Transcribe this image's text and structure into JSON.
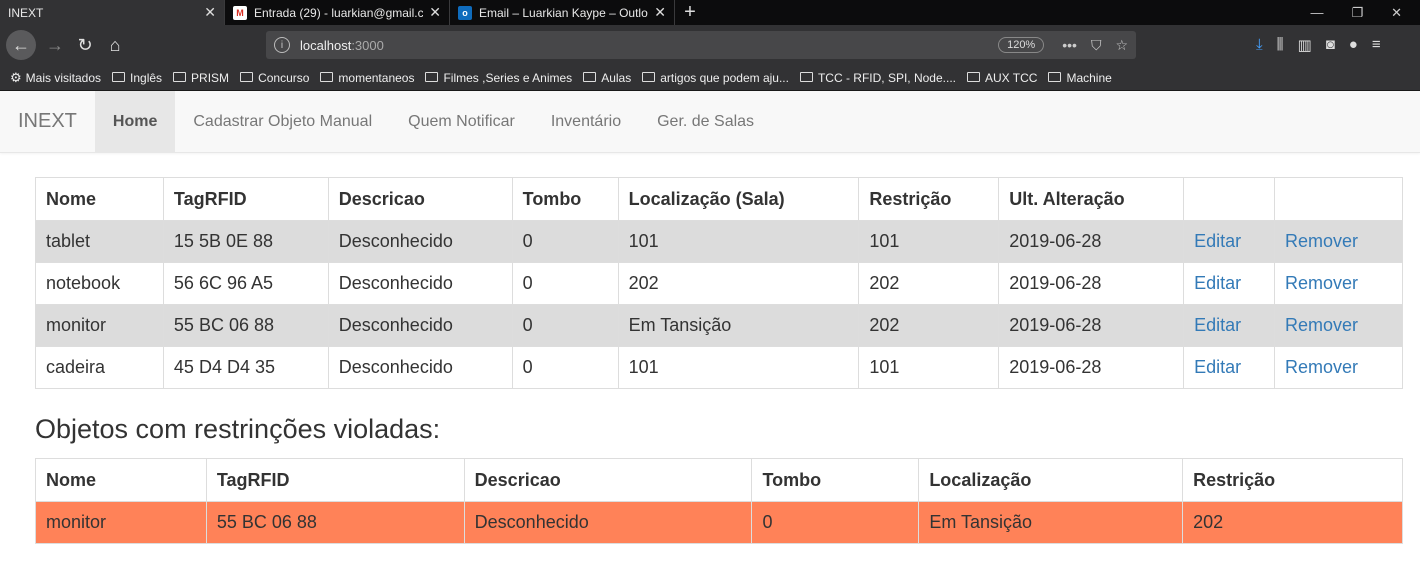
{
  "browser": {
    "tabs": [
      {
        "title": "INEXT",
        "icon": "page-icon"
      },
      {
        "title": "Entrada (29) - luarkian@gmail.c",
        "icon": "gmail-icon"
      },
      {
        "title": "Email – Luarkian Kaype – Outlo",
        "icon": "outlook-icon"
      }
    ],
    "url_host": "localhost",
    "url_port": ":3000",
    "zoom": "120%",
    "bookmarks": [
      {
        "label": "Mais visitados",
        "icon": "gear-icon"
      },
      {
        "label": "Inglês",
        "icon": "folder-icon"
      },
      {
        "label": "PRISM",
        "icon": "folder-icon"
      },
      {
        "label": "Concurso",
        "icon": "folder-icon"
      },
      {
        "label": "momentaneos",
        "icon": "folder-icon"
      },
      {
        "label": "Filmes ,Series e Animes",
        "icon": "folder-icon"
      },
      {
        "label": "Aulas",
        "icon": "folder-icon"
      },
      {
        "label": "artigos que podem aju...",
        "icon": "folder-icon"
      },
      {
        "label": "TCC - RFID, SPI, Node....",
        "icon": "folder-icon"
      },
      {
        "label": "AUX TCC",
        "icon": "folder-icon"
      },
      {
        "label": "Machine",
        "icon": "folder-icon"
      }
    ]
  },
  "app": {
    "brand": "INEXT",
    "nav": [
      {
        "label": "Home",
        "active": true
      },
      {
        "label": "Cadastrar Objeto Manual"
      },
      {
        "label": "Quem Notificar"
      },
      {
        "label": "Inventário"
      },
      {
        "label": "Ger. de Salas"
      }
    ]
  },
  "objects_table": {
    "headers": [
      "Nome",
      "TagRFID",
      "Descricao",
      "Tombo",
      "Localização (Sala)",
      "Restrição",
      "Ult. Alteração",
      "",
      ""
    ],
    "rows": [
      {
        "nome": "tablet",
        "tag": "15 5B 0E 88",
        "descricao": "Desconhecido",
        "tombo": "0",
        "localizacao": "101",
        "restricao": "101",
        "alteracao": "2019-06-28",
        "edit": "Editar",
        "remove": "Remover"
      },
      {
        "nome": "notebook",
        "tag": "56 6C 96 A5",
        "descricao": "Desconhecido",
        "tombo": "0",
        "localizacao": "202",
        "restricao": "202",
        "alteracao": "2019-06-28",
        "edit": "Editar",
        "remove": "Remover"
      },
      {
        "nome": "monitor",
        "tag": "55 BC 06 88",
        "descricao": "Desconhecido",
        "tombo": "0",
        "localizacao": "Em Tansição",
        "restricao": "202",
        "alteracao": "2019-06-28",
        "edit": "Editar",
        "remove": "Remover"
      },
      {
        "nome": "cadeira",
        "tag": "45 D4 D4 35",
        "descricao": "Desconhecido",
        "tombo": "0",
        "localizacao": "101",
        "restricao": "101",
        "alteracao": "2019-06-28",
        "edit": "Editar",
        "remove": "Remover"
      }
    ]
  },
  "violations": {
    "title": "Objetos com restrinções violadas:",
    "headers": [
      "Nome",
      "TagRFID",
      "Descricao",
      "Tombo",
      "Localização",
      "Restrição"
    ],
    "rows": [
      {
        "nome": "monitor",
        "tag": "55 BC 06 88",
        "descricao": "Desconhecido",
        "tombo": "0",
        "localizacao": "Em Tansição",
        "restricao": "202"
      }
    ]
  },
  "colors": {
    "link": "#337ab7",
    "stripe": "#dcdcdc",
    "violation": "#ff8258"
  }
}
